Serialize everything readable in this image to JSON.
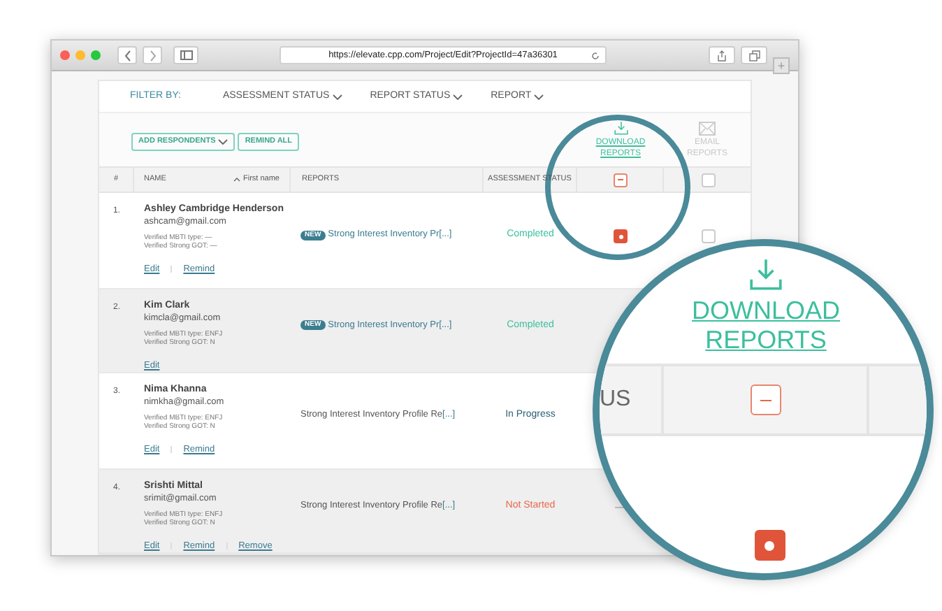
{
  "browser": {
    "url": "https://elevate.cpp.com/Project/Edit?ProjectId=47a36301",
    "new_tab": "+"
  },
  "filter": {
    "label": "FILTER BY:",
    "options": [
      "ASSESSMENT STATUS",
      "REPORT STATUS",
      "REPORT"
    ]
  },
  "buttons": [
    {
      "label": "ADD RESPONDENTS",
      "kind": "dropdown"
    },
    {
      "label": "REMIND ALL",
      "kind": "plain"
    }
  ],
  "bulk_actions": [
    {
      "label": "DOWNLOAD REPORTS",
      "kind": "download",
      "disabled": false
    },
    {
      "label": "EMAIL REPORTS",
      "kind": "email",
      "disabled": true
    }
  ],
  "table": {
    "columns": [
      "#",
      "NAME",
      "REPORTS",
      "ASSESSMENT STATUS"
    ],
    "sort": "First name",
    "header_download": {
      "indeterminate": true
    },
    "header_email": {
      "checked": false
    },
    "rows": [
      {
        "number": "1.",
        "name": "Ashley Cambridge Henderson",
        "email": "ashcam@gmail.com",
        "mbti": "Verified MBTI type: —",
        "strong": "Verified Strong GOT: —",
        "badge": "NEW",
        "report": "Strong Interest Inventory Pr",
        "more": "[...]",
        "status": "Completed",
        "color": "#3cbf9d",
        "actions": [
          "Edit",
          "Remind"
        ],
        "download": {
          "kind": "checkbox",
          "checked": true
        },
        "email_report": {
          "kind": "checkbox",
          "checked": false
        }
      },
      {
        "number": "2.",
        "name": "Kim Clark",
        "email": "kimcla@gmail.com",
        "mbti": "Verified MBTI type: ENFJ",
        "strong": "Verified Strong GOT: N",
        "badge": "NEW",
        "report": "Strong Interest Inventory Pr",
        "more": "[...]",
        "status": "Completed",
        "color": "#3cbf9d",
        "actions": [
          "Edit"
        ]
      },
      {
        "number": "3.",
        "name": "Nima Khanna",
        "email": "nimkha@gmail.com",
        "mbti": "Verified MBTI type: ENFJ",
        "strong": "Verified Strong GOT: N",
        "report": "Strong Interest Inventory Profile Re",
        "more": "[...]",
        "status": "In Progress",
        "color": "#2b5f73",
        "actions": [
          "Edit",
          "Remind"
        ]
      },
      {
        "number": "4.",
        "name": "Srishti Mittal",
        "email": "srimit@gmail.com",
        "mbti": "Verified MBTI type: ENFJ",
        "strong": "Verified Strong GOT: N",
        "report": "Strong Interest Inventory Profile Re",
        "more": "[...]",
        "status": "Not Started",
        "color": "#e8664a",
        "actions": [
          "Edit",
          "Remind",
          "Remove"
        ],
        "download": {
          "kind": "dash",
          "text": "—"
        }
      }
    ]
  },
  "magnifier": {
    "label": "DOWNLOAD REPORTS",
    "header_fragment": "US",
    "header_checkbox": {
      "indeterminate": true
    },
    "row_checkbox": {
      "checked": true
    }
  }
}
